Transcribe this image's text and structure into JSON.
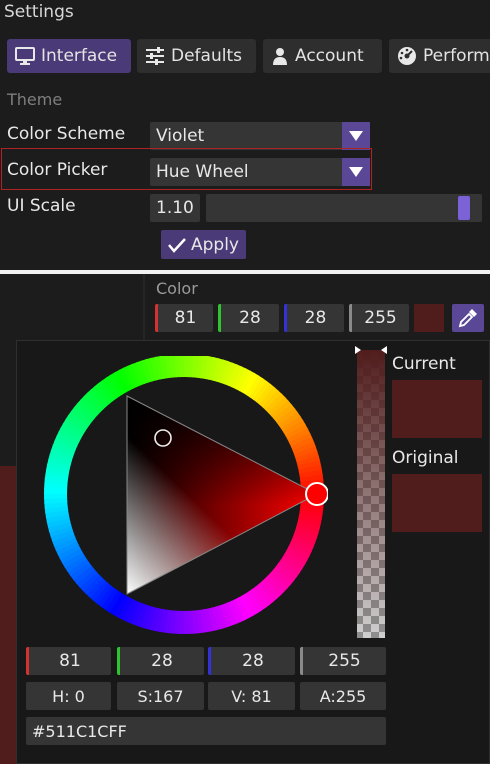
{
  "window": {
    "title": "Settings"
  },
  "tabs": [
    {
      "label": "Interface",
      "icon": "monitor-icon"
    },
    {
      "label": "Defaults",
      "icon": "sliders-icon"
    },
    {
      "label": "Account",
      "icon": "user-icon"
    },
    {
      "label": "Perform",
      "icon": "gauge-icon"
    }
  ],
  "theme": {
    "section": "Theme",
    "color_scheme_label": "Color Scheme",
    "color_scheme_value": "Violet",
    "color_picker_label": "Color Picker",
    "color_picker_value": "Hue Wheel",
    "ui_scale_label": "UI Scale",
    "ui_scale_value": "1.10",
    "ui_scale_fraction": 0.97,
    "apply_label": "Apply"
  },
  "color": {
    "label": "Color",
    "r": "81",
    "g": "28",
    "b": "28",
    "a": "255",
    "swatch": "#511c1c"
  },
  "picker": {
    "current_label": "Current",
    "original_label": "Original",
    "r": "81",
    "g": "28",
    "b": "28",
    "a": "255",
    "h": "H:  0",
    "s": "S:167",
    "v": "V: 81",
    "alpha": "A:255",
    "hex": "#511C1CFF"
  },
  "colors": {
    "accent": "#5a4795",
    "tab_active": "#4a3a78",
    "highlight": "#b02323",
    "red": "#d23232",
    "green": "#2fc42f",
    "blue": "#3232d8",
    "gray": "#8a8a8a"
  }
}
